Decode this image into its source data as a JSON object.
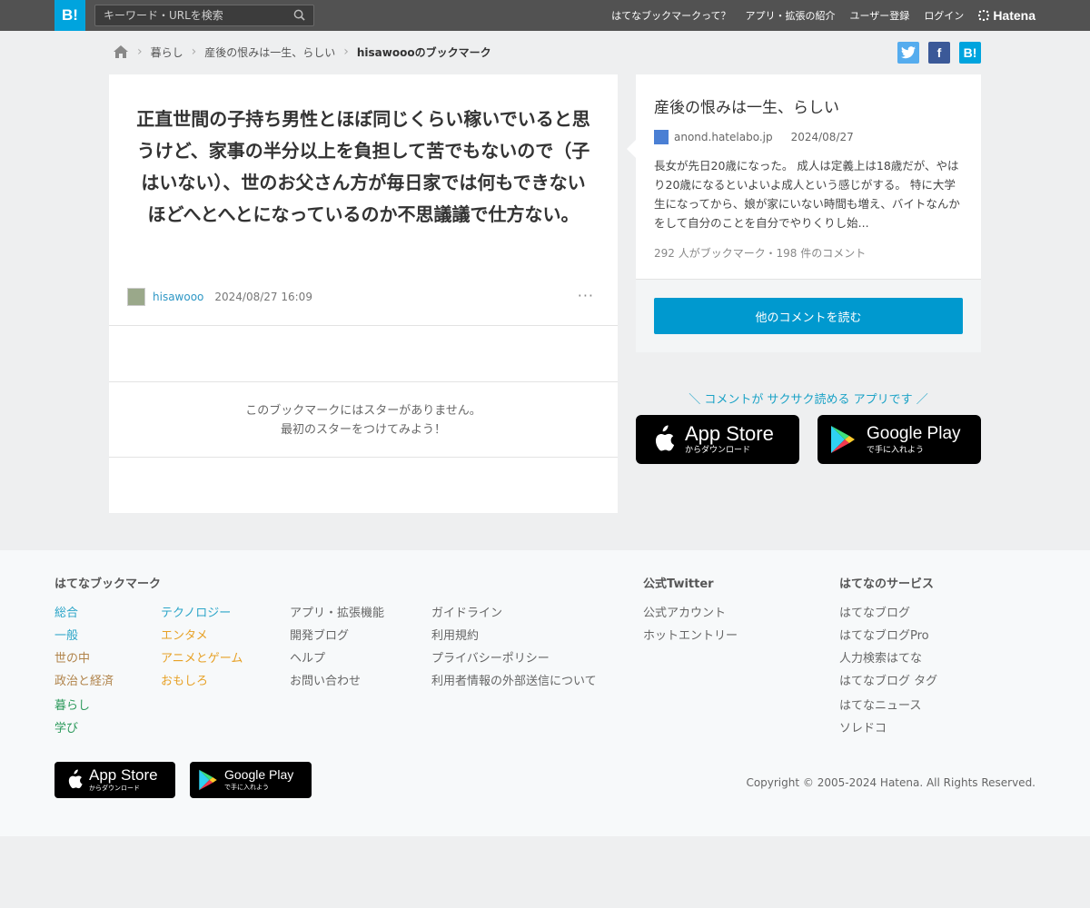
{
  "header": {
    "logo": "B!",
    "search_placeholder": "キーワード・URLを検索",
    "nav": [
      "はてなブックマークって？",
      "アプリ・拡張の紹介",
      "ユーザー登録",
      "ログイン"
    ],
    "brand": "Hatena"
  },
  "breadcrumb": {
    "items": [
      "暮らし",
      "産後の恨みは一生、らしい"
    ],
    "current": "hisawoooのブックマーク"
  },
  "share": {
    "hatena": "B!"
  },
  "bookmark": {
    "comment": "正直世間の子持ち男性とほぼ同じくらい稼いでいると思うけど、家事の半分以上を負担して苦でもないので（子はいない）、世のお父さん方が毎日家では何もできないほどへとへとになっているのか不思議議で仕方ない。",
    "user": "hisawooo",
    "datetime": "2024/08/27 16:09",
    "more": "···",
    "no_star_line1": "このブックマークにはスターがありません。",
    "no_star_line2": "最初のスターをつけてみよう！"
  },
  "entry": {
    "title": "産後の恨みは一生、らしい",
    "domain": "anond.hatelabo.jp",
    "date": "2024/08/27",
    "description": "長女が先日20歳になった。 成人は定義上は18歳だが、やはり20歳になるといよいよ成人という感じがする。 特に大学生になってから、娘が家にいない時間も増え、バイトなんかをして自分のことを自分でやりくりし始...",
    "count": "292 人がブックマーク・198 件のコメント",
    "read_more": "他のコメントを読む"
  },
  "promo": {
    "text": "＼ コメントが サクサク読める アプリです ／",
    "appstore_big": "App Store",
    "appstore_small": "からダウンロード",
    "googleplay_big": "Google Play",
    "googleplay_small": "で手に入れよう"
  },
  "footer": {
    "bookmark_title": "はてなブックマーク",
    "categories_col1": [
      "総合",
      "一般",
      "世の中",
      "政治と経済",
      "暮らし",
      "学び"
    ],
    "categories_col2": [
      "テクノロジー",
      "エンタメ",
      "アニメとゲーム",
      "おもしろ"
    ],
    "links_col3": [
      "アプリ・拡張機能",
      "開発ブログ",
      "ヘルプ",
      "お問い合わせ"
    ],
    "links_col4": [
      "ガイドライン",
      "利用規約",
      "プライバシーポリシー",
      "利用者情報の外部送信について"
    ],
    "twitter_title": "公式Twitter",
    "twitter_links": [
      "公式アカウント",
      "ホットエントリー"
    ],
    "services_title": "はてなのサービス",
    "services_links": [
      "はてなブログ",
      "はてなブログPro",
      "人力検索はてな",
      "はてなブログ タグ",
      "はてなニュース",
      "ソレドコ"
    ],
    "copyright": "Copyright © 2005-2024 Hatena. All Rights Reserved."
  },
  "colors": {
    "accent": "#00a4de",
    "button": "#0099cf",
    "cat_general": "#2ba5c8",
    "cat_tech": "#2ba5c8",
    "cat_entertainment": "#e7a126",
    "cat_world": "#b0834a",
    "cat_life": "#2d9a5c"
  }
}
